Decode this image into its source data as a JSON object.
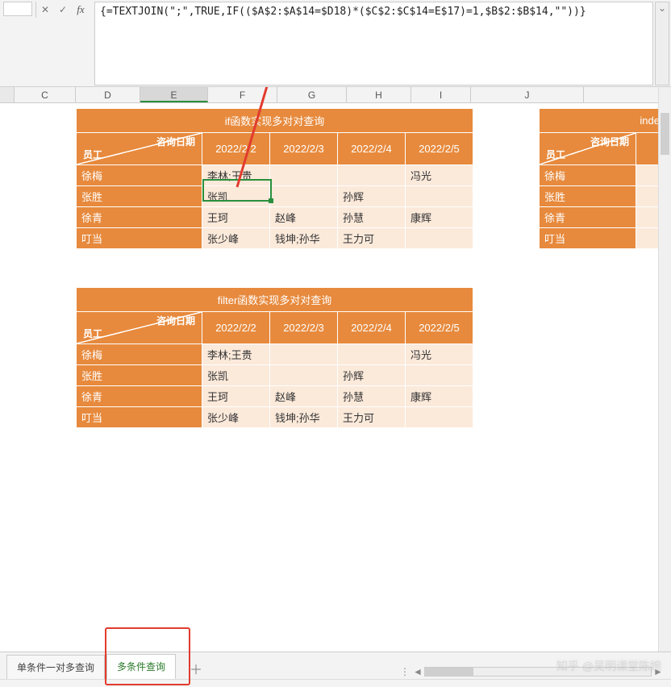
{
  "formula_bar": {
    "cancel_glyph": "✕",
    "accept_glyph": "✓",
    "fx_glyph": "fx",
    "formula": "{=TEXTJOIN(\";\",TRUE,IF(($A$2:$A$14=$D18)*($C$2:$C$14=E$17)=1,$B$2:$B$14,\"\"))}",
    "expand_glyph": "⌄"
  },
  "columns": [
    "C",
    "D",
    "E",
    "F",
    "G",
    "H",
    "I",
    "J"
  ],
  "selected_column": "E",
  "table1": {
    "title": "if函数实现多对对查询",
    "diag_top": "咨询日期",
    "diag_bottom": "员工",
    "headers": [
      "2022/2/2",
      "2022/2/3",
      "2022/2/4",
      "2022/2/5"
    ],
    "rows": [
      {
        "label": "徐梅",
        "cells": [
          "李林;王贵",
          "",
          "",
          "冯光"
        ]
      },
      {
        "label": "张胜",
        "cells": [
          "张凯",
          "",
          "孙辉",
          ""
        ]
      },
      {
        "label": "徐青",
        "cells": [
          "王珂",
          "赵峰",
          "孙慧",
          "康辉"
        ]
      },
      {
        "label": "叮当",
        "cells": [
          "张少峰",
          "钱坤;孙华",
          "王力可",
          ""
        ]
      }
    ]
  },
  "table2": {
    "title": "filter函数实现多对对查询",
    "diag_top": "咨询日期",
    "diag_bottom": "员工",
    "headers": [
      "2022/2/2",
      "2022/2/3",
      "2022/2/4",
      "2022/2/5"
    ],
    "rows": [
      {
        "label": "徐梅",
        "cells": [
          "李林;王贵",
          "",
          "",
          "冯光"
        ]
      },
      {
        "label": "张胜",
        "cells": [
          "张凯",
          "",
          "孙辉",
          ""
        ]
      },
      {
        "label": "徐青",
        "cells": [
          "王珂",
          "赵峰",
          "孙慧",
          "康辉"
        ]
      },
      {
        "label": "叮当",
        "cells": [
          "张少峰",
          "钱坤;孙华",
          "王力可",
          ""
        ]
      }
    ]
  },
  "table3": {
    "title_partial": "inde",
    "diag_top": "咨询日期",
    "diag_bottom": "员工",
    "rows": [
      "徐梅",
      "张胜",
      "徐青",
      "叮当"
    ]
  },
  "tabs": {
    "tab1": "单条件一对多查询",
    "tab2": "多条件查询",
    "add_glyph": "＋"
  },
  "scroll": {
    "left": "◄",
    "right": "►",
    "sep": "⋮"
  },
  "watermark": "知乎 @吴明课堂陈婉"
}
